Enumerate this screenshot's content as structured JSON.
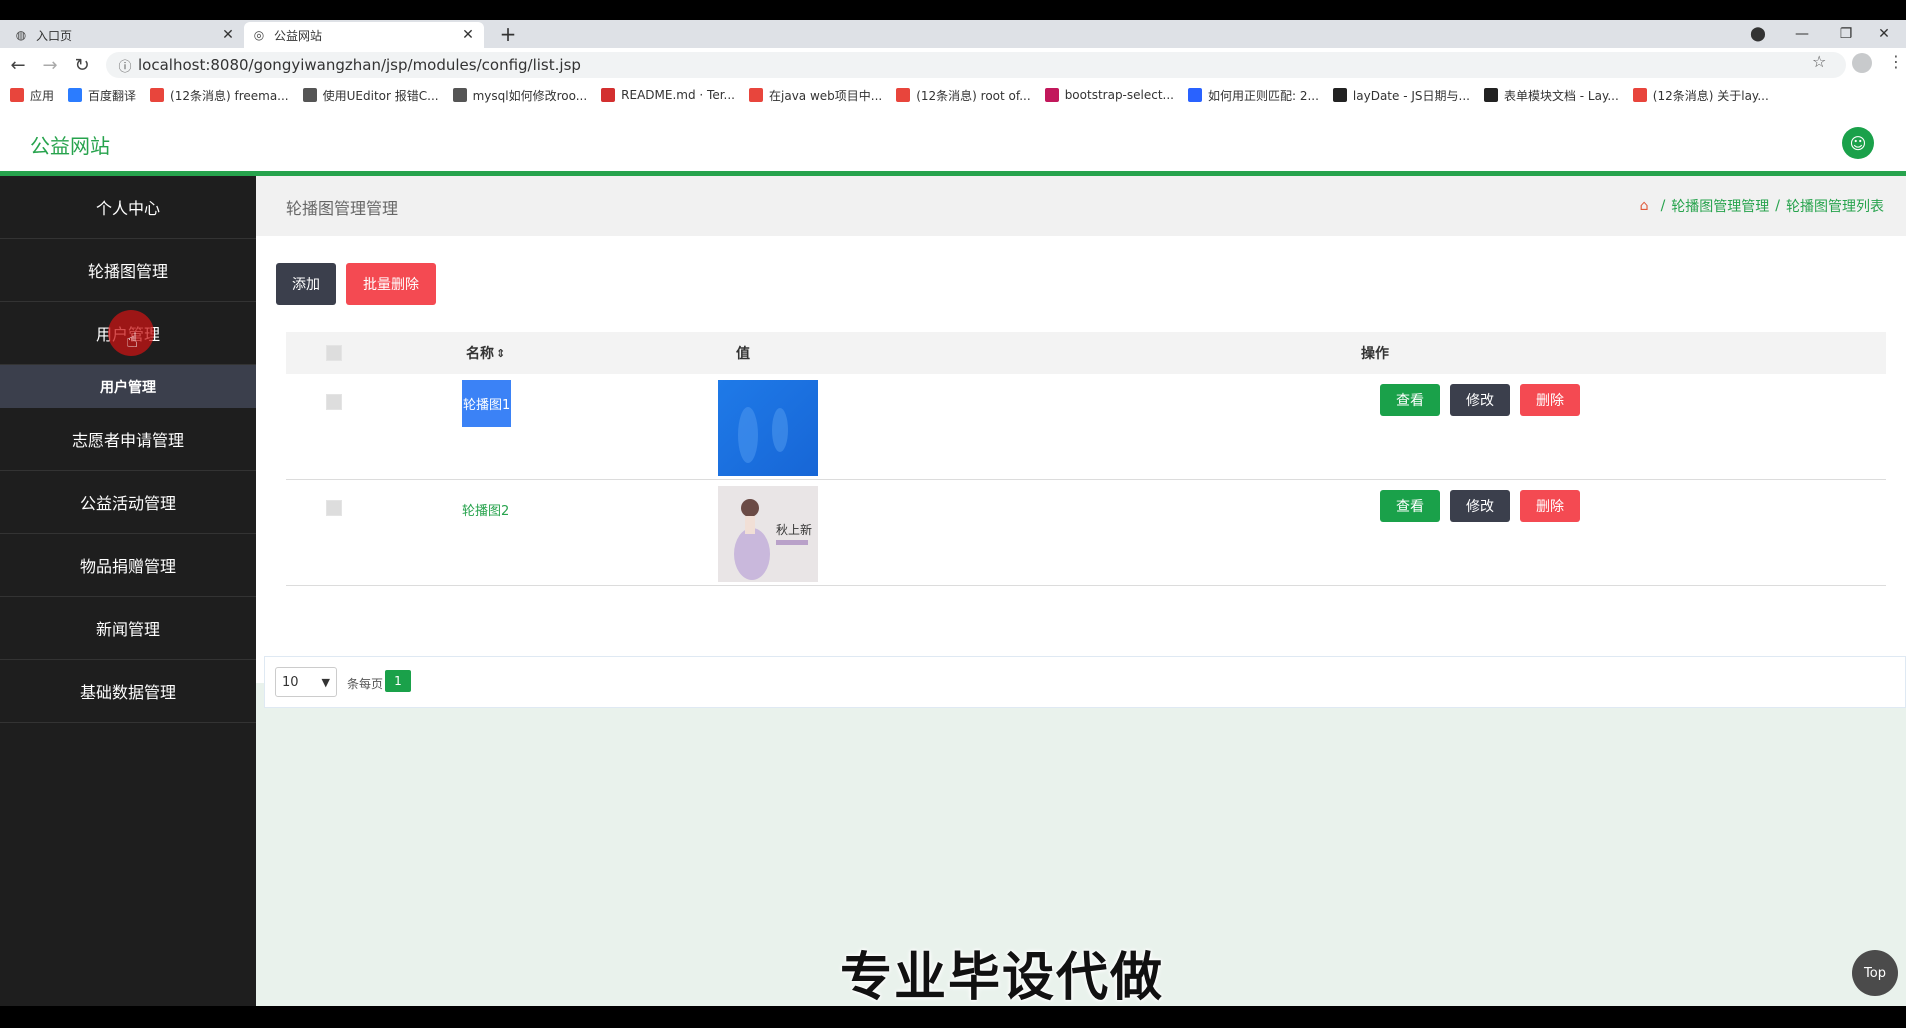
{
  "browser": {
    "tabs": [
      {
        "title": "入口页",
        "active": false
      },
      {
        "title": "公益网站",
        "active": true
      }
    ],
    "url": "localhost:8080/gongyiwangzhan/jsp/modules/config/list.jsp",
    "bookmarks": [
      {
        "label": "应用",
        "color": "#e8453c"
      },
      {
        "label": "百度翻译",
        "color": "#2b7cff"
      },
      {
        "label": "(12条消息) freema...",
        "color": "#e8453c"
      },
      {
        "label": "使用UEditor 报错C...",
        "color": "#555555"
      },
      {
        "label": "mysql如何修改roo...",
        "color": "#555555"
      },
      {
        "label": "README.md · Ter...",
        "color": "#d32f2f"
      },
      {
        "label": "在java web项目中...",
        "color": "#e8453c"
      },
      {
        "label": "(12条消息) root of...",
        "color": "#e8453c"
      },
      {
        "label": "bootstrap-select...",
        "color": "#c2185b"
      },
      {
        "label": "如何用正则匹配: 2...",
        "color": "#2962ff"
      },
      {
        "label": "layDate - JS日期与...",
        "color": "#222222"
      },
      {
        "label": "表单模块文档 - Lay...",
        "color": "#222222"
      },
      {
        "label": "(12条消息) 关于lay...",
        "color": "#e8453c"
      }
    ]
  },
  "header": {
    "logo": "公益网站"
  },
  "sidebar": {
    "items": [
      {
        "label": "个人中心"
      },
      {
        "label": "轮播图管理"
      },
      {
        "label": "用户管理"
      },
      {
        "label": "志愿者申请管理"
      },
      {
        "label": "公益活动管理"
      },
      {
        "label": "物品捐赠管理"
      },
      {
        "label": "新闻管理"
      },
      {
        "label": "基础数据管理"
      }
    ],
    "sub_item": "用户管理"
  },
  "main": {
    "title": "轮播图管理管理",
    "breadcrumb": [
      "轮播图管理管理",
      "轮播图管理列表"
    ],
    "add_label": "添加",
    "batch_delete_label": "批量删除",
    "columns": {
      "name": "名称",
      "value": "值",
      "ops": "操作"
    },
    "rows": [
      {
        "name": "轮播图1",
        "selected": true
      },
      {
        "name": "轮播图2",
        "selected": false
      }
    ],
    "ops": {
      "view": "查看",
      "edit": "修改",
      "delete": "删除"
    },
    "colors": {
      "view": "#1aa14a",
      "edit": "#3b3f4c",
      "delete": "#f44a52"
    },
    "pager": {
      "page_size": "10",
      "per_page_label": "条每页",
      "current_page": "1"
    }
  },
  "thumb2_text": "秋上新",
  "watermark": "专业毕设代做",
  "top_button": "Top"
}
